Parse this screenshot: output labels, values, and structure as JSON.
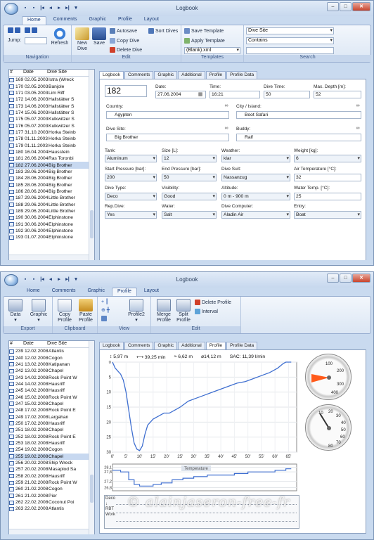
{
  "window1": {
    "title": "Logbook",
    "qat": [
      "▪",
      "▪",
      "|◂",
      "◂",
      "▸",
      "▸|",
      "▾"
    ],
    "tabs": [
      "Home",
      "Comments",
      "Graphic",
      "Profile",
      "Layout"
    ],
    "ribbon": {
      "navigation": {
        "label": "Navigation",
        "jump_label": "Jump:",
        "refresh": "Refresh"
      },
      "edit": {
        "label": "Edit",
        "new_dive": "New\nDive",
        "save": "Save",
        "autosave": "Autosave",
        "copy_dive": "Copy Dive",
        "delete_dive": "Delete Dive",
        "sort_dives": "Sort Dives"
      },
      "templates": {
        "label": "Templates",
        "save_template": "Save Template",
        "apply_template": "Apply Template",
        "template_value": "(Blank).xml"
      },
      "search": {
        "label": "Search",
        "field": "Dive Site",
        "mode": "Contains",
        "value": ""
      }
    },
    "list": {
      "headers": [
        "#",
        "Date",
        "Dive Site"
      ],
      "rows": [
        [
          "169",
          "02.05.2003",
          "Istra (Wreck"
        ],
        [
          "170",
          "02.05.2003",
          "Banjole"
        ],
        [
          "171",
          "03.05.2003",
          "Lim Riff"
        ],
        [
          "172",
          "14.06.2003",
          "Hallstätter S"
        ],
        [
          "173",
          "14.06.2003",
          "Hallstätter S"
        ],
        [
          "174",
          "15.06.2003",
          "Hallstätter S"
        ],
        [
          "175",
          "05.07.2003",
          "Kulkwitzer S"
        ],
        [
          "176",
          "05.07.2003",
          "Kulkwitzer S"
        ],
        [
          "177",
          "31.10.2003",
          "Horka Steinb"
        ],
        [
          "178",
          "01.11.2003",
          "Horka Steinb"
        ],
        [
          "179",
          "01.11.2003",
          "Horka Steinb"
        ],
        [
          "180",
          "16.04.2004",
          "Hausstein"
        ],
        [
          "181",
          "26.06.2004",
          "Ras Toronbi"
        ],
        [
          "182",
          "27.06.2004",
          "Big Brother"
        ],
        [
          "183",
          "28.06.2004",
          "Big Brother"
        ],
        [
          "184",
          "28.06.2004",
          "Big Brother"
        ],
        [
          "185",
          "28.06.2004",
          "Big Brother"
        ],
        [
          "186",
          "28.06.2004",
          "Big Brother"
        ],
        [
          "187",
          "29.06.2004",
          "Little Brother"
        ],
        [
          "188",
          "29.06.2004",
          "Little Brother"
        ],
        [
          "189",
          "29.06.2004",
          "Little Brother"
        ],
        [
          "190",
          "30.06.2004",
          "Elphinstone"
        ],
        [
          "191",
          "30.06.2004",
          "Elphinstone"
        ],
        [
          "192",
          "30.06.2004",
          "Elphinstone"
        ],
        [
          "193",
          "01.07.2004",
          "Elphinstone"
        ]
      ],
      "selected_index": 13
    },
    "panel_tabs": [
      "Logbook",
      "Comments",
      "Graphic",
      "Additional",
      "Profile",
      "Profile Data"
    ],
    "form": {
      "dive_no": "182",
      "date_label": "Date:",
      "date": "27.06.2004",
      "time_label": "Time:",
      "time": "16:21",
      "dive_time_label": "Dive Time:",
      "dive_time": "50",
      "max_depth_label": "Max. Depth [m]:",
      "max_depth": "52",
      "country_label": "Country:",
      "country": "Agypten",
      "city_label": "City / Island:",
      "city": "Boot Safari",
      "site_label": "Dive Site:",
      "site": "Big Brother",
      "buddy_label": "Buddy:",
      "buddy": "Ralf",
      "tank_label": "Tank:",
      "tank": "Aluminum",
      "size_label": "Size [L]:",
      "size": "12",
      "weather_label": "Weather:",
      "weather": "klar",
      "weight_label": "Weight [kg]:",
      "weight": "6",
      "start_label": "Start Pressure [bar]:",
      "start": "200",
      "end_label": "End Pressure [bar]:",
      "end": "50",
      "suit_label": "Dive Suit:",
      "suit": "Nassanzug",
      "air_label": "Air Temperature [°C]:",
      "air": "32",
      "type_label": "Dive Type:",
      "type": "Deco",
      "vis_label": "Visibility:",
      "vis": "Good",
      "alt_label": "Altitude:",
      "alt": "0 m - 900 m",
      "water_temp_label": "Water Temp. [°C]:",
      "water_temp": "25",
      "rep_label": "Rep.Dive:",
      "rep": "Yes",
      "water_label": "Water:",
      "water": "Salt",
      "computer_label": "Dive Computer:",
      "computer": "Aladin Air",
      "entry_label": "Entry:",
      "entry": "Boat"
    }
  },
  "window2": {
    "title": "Logbook",
    "tabs": [
      "Home",
      "Comments",
      "Graphic",
      "Profile",
      "Layout"
    ],
    "ribbon": {
      "export": {
        "label": "Export",
        "data": "Data",
        "graphic": "Graphic"
      },
      "clipboard": {
        "label": "Clipboard",
        "copy_profile": "Copy\nProfile",
        "paste_profile": "Paste\nProfile"
      },
      "view": {
        "label": "View",
        "profile2": "Profile2"
      },
      "edit": {
        "label": "Edit",
        "merge": "Merge\nProfile",
        "split": "Split\nProfile",
        "delete_profile": "Delete Profile",
        "interval": "Interval"
      }
    },
    "list": {
      "headers": [
        "#",
        "Date",
        "Dive Site"
      ],
      "rows": [
        [
          "239",
          "12.02.2008",
          "Atlantis"
        ],
        [
          "240",
          "12.02.2008",
          "Cogon"
        ],
        [
          "241",
          "13.02.2008",
          "Katipanan"
        ],
        [
          "242",
          "13.02.2008",
          "Chapel"
        ],
        [
          "243",
          "14.02.2008",
          "Rock Point W"
        ],
        [
          "244",
          "14.02.2008",
          "Hausriff"
        ],
        [
          "245",
          "14.02.2008",
          "Hausriff"
        ],
        [
          "246",
          "15.02.2008",
          "Rock Point W"
        ],
        [
          "247",
          "15.02.2008",
          "Chapel"
        ],
        [
          "248",
          "17.02.2008",
          "Rock Point E"
        ],
        [
          "249",
          "17.02.2008",
          "Largahan"
        ],
        [
          "250",
          "17.02.2008",
          "Hausriff"
        ],
        [
          "251",
          "18.02.2008",
          "Chapel"
        ],
        [
          "252",
          "18.02.2008",
          "Rock Point E"
        ],
        [
          "253",
          "18.02.2008",
          "Hausriff"
        ],
        [
          "254",
          "19.02.2008",
          "Cogon"
        ],
        [
          "255",
          "19.02.2008",
          "Chapel"
        ],
        [
          "256",
          "20.02.2008",
          "Ship Wreck"
        ],
        [
          "257",
          "20.02.2008",
          "Masaplod Sa"
        ],
        [
          "258",
          "20.02.2008",
          "Hausriff"
        ],
        [
          "259",
          "21.02.2008",
          "Rock Point W"
        ],
        [
          "260",
          "21.02.2008",
          "Cogon"
        ],
        [
          "261",
          "21.02.2008",
          "Pier"
        ],
        [
          "262",
          "22.02.2008",
          "Coconut Poi"
        ],
        [
          "263",
          "22.02.2008",
          "Atlantis"
        ]
      ],
      "selected_index": 16
    },
    "panel_tabs": [
      "Logbook",
      "Comments",
      "Graphic",
      "Additional",
      "Profile",
      "Profile Data"
    ],
    "stats": [
      "5,97 m",
      "39,25 min",
      "6,62 m",
      "ø14,12 m",
      "SAC: 11,39 l/min"
    ],
    "temp_label": "Temperature",
    "deco_labels": [
      "Deco",
      "↓",
      "RBT",
      "Work"
    ]
  },
  "colors": {
    "accent": "#3a66c4",
    "profile": "#3f6fd0",
    "gauge_needle": "#ff5a1a"
  },
  "watermark": "© alainjaseron-free-fr",
  "chart_data": [
    {
      "type": "line",
      "title": "",
      "xlabel": "",
      "ylabel": "",
      "x_ticks": [
        "0'",
        "5'",
        "10'",
        "15'",
        "20'",
        "25'",
        "30'",
        "35'",
        "40'",
        "45'",
        "50'",
        "55'",
        "60'",
        "65'"
      ],
      "y_ticks": [
        "0",
        "5",
        "10",
        "15",
        "20",
        "25",
        "30"
      ],
      "xlim": [
        0,
        68
      ],
      "ylim": [
        30,
        0
      ],
      "series": [
        {
          "name": "",
          "x": [
            0,
            1,
            2,
            3,
            4,
            5,
            6,
            7,
            8,
            9,
            10,
            11,
            12,
            13,
            15,
            17,
            19,
            21,
            23,
            25,
            28,
            31,
            34,
            37,
            40,
            43,
            46,
            49,
            52,
            55,
            58,
            61,
            63,
            64,
            65,
            66
          ],
          "y": [
            0,
            2,
            3,
            4,
            6,
            10,
            16,
            22,
            27,
            29,
            29.5,
            28,
            24,
            21,
            19,
            18,
            17,
            17,
            16,
            15,
            13,
            12,
            11,
            10,
            9,
            8,
            7,
            6.5,
            5.5,
            4.5,
            3.5,
            2,
            0.5,
            0,
            0,
            0
          ]
        }
      ]
    },
    {
      "type": "line",
      "title": "Temperature",
      "y_ticks": [
        "28,1",
        "27,8",
        "27,2",
        "26,8"
      ],
      "ylim": [
        26.6,
        28.3
      ],
      "xlim": [
        0,
        68
      ],
      "series": [
        {
          "name": "",
          "x": [
            0,
            3,
            6,
            8,
            10,
            12,
            15,
            18,
            22,
            26,
            30,
            35,
            40,
            45,
            50,
            55,
            60,
            64,
            66
          ],
          "y": [
            27.9,
            27.8,
            27.3,
            27.0,
            26.9,
            26.9,
            27.0,
            27.1,
            27.3,
            27.4,
            27.5,
            27.6,
            27.6,
            27.7,
            27.8,
            27.8,
            27.9,
            28.0,
            28.0
          ]
        }
      ]
    }
  ]
}
